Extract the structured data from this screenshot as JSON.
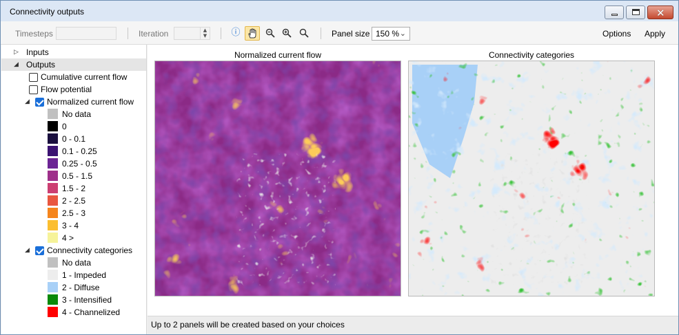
{
  "window": {
    "title": "Connectivity outputs"
  },
  "toolbar": {
    "timesteps_label": "Timesteps",
    "timesteps_value": "",
    "iteration_label": "Iteration",
    "iteration_value": "",
    "panel_size_label": "Panel size",
    "panel_size_value": "150 %",
    "options_label": "Options",
    "apply_label": "Apply",
    "tools": [
      "info-icon",
      "pan-hand-icon",
      "zoom-out-icon",
      "zoom-in-icon",
      "zoom-extent-icon"
    ]
  },
  "tree": {
    "inputs_label": "Inputs",
    "outputs_label": "Outputs",
    "cumulative_label": "Cumulative current flow",
    "flow_potential_label": "Flow potential",
    "normalized_label": "Normalized current flow",
    "normalized_legend": [
      {
        "label": "No data",
        "color": "#c0c0c0"
      },
      {
        "label": "0",
        "color": "#000000"
      },
      {
        "label": "0 - 0.1",
        "color": "#1a0f3e"
      },
      {
        "label": "0.1 - 0.25",
        "color": "#3b1372"
      },
      {
        "label": "0.25 - 0.5",
        "color": "#6b2494"
      },
      {
        "label": "0.5 - 1.5",
        "color": "#9e2f8a"
      },
      {
        "label": "1.5 - 2",
        "color": "#cc3f72"
      },
      {
        "label": "2 - 2.5",
        "color": "#e9573f"
      },
      {
        "label": "2.5 - 3",
        "color": "#f5851c"
      },
      {
        "label": "3 - 4",
        "color": "#fbbe30"
      },
      {
        "label": "4 >",
        "color": "#f6f39a"
      }
    ],
    "categories_label": "Connectivity categories",
    "categories_legend": [
      {
        "label": "No data",
        "color": "#c0c0c0"
      },
      {
        "label": "1 - Impeded",
        "color": "#ededed"
      },
      {
        "label": "2 - Diffuse",
        "color": "#a8d0f7"
      },
      {
        "label": "3 - Intensified",
        "color": "#0a8a0a"
      },
      {
        "label": "4 - Channelized",
        "color": "#ff0000"
      }
    ]
  },
  "panels": {
    "left_title": "Normalized current flow",
    "right_title": "Connectivity categories"
  },
  "status": {
    "message": "Up to 2 panels will be created based on your choices"
  }
}
